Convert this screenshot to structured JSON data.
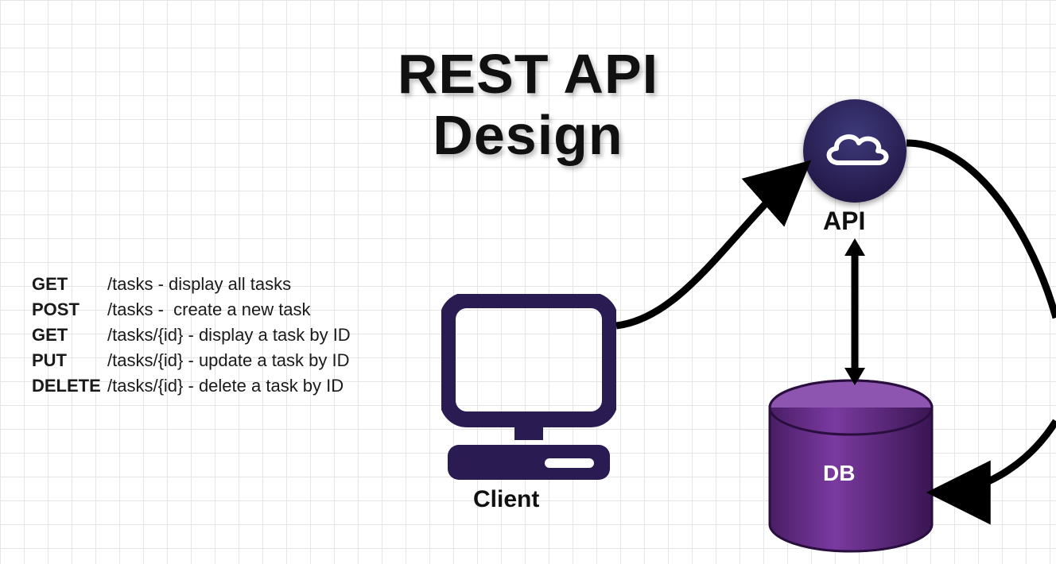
{
  "title_line1": "REST API",
  "title_line2": "Design",
  "endpoints": [
    {
      "method": "GET",
      "path": "/tasks - display all tasks"
    },
    {
      "method": "POST",
      "path": "/tasks -  create a new task"
    },
    {
      "method": "GET",
      "path": "/tasks/{id} - display a task by ID"
    },
    {
      "method": "PUT",
      "path": "/tasks/{id} - update a task by ID"
    },
    {
      "method": "DELETE",
      "path": "/tasks/{id} - delete a task by ID"
    }
  ],
  "labels": {
    "client": "Client",
    "api": "API",
    "db": "DB"
  },
  "colors": {
    "ink": "#2a1b52",
    "db_fill": "#6f2f8f",
    "api_fill": "#261b4d"
  }
}
